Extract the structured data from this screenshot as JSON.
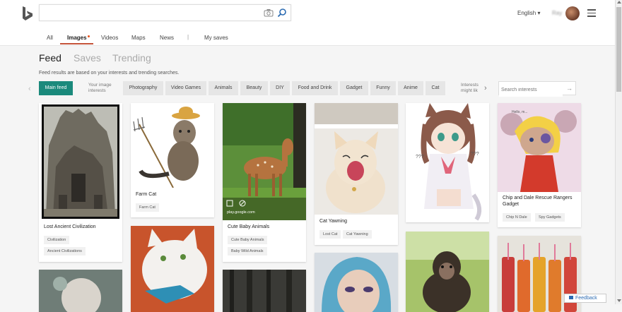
{
  "header": {
    "logo_icon": "bing-logo",
    "search_placeholder": "",
    "lang": "English ▾",
    "user": "Ray"
  },
  "nav": {
    "all": "All",
    "images": "Images",
    "videos": "Videos",
    "maps": "Maps",
    "news": "News",
    "sep": "|",
    "saves": "My saves"
  },
  "feed": {
    "tabs": [
      "Feed",
      "Saves",
      "Trending"
    ],
    "note": "Feed results are based on your interests and trending searches.",
    "main_feed": "Main feed",
    "your_image_interests": "Your image interests",
    "chips": [
      "Photography",
      "Video Games",
      "Animals",
      "Beauty",
      "DIY",
      "Food and Drink",
      "Gadget",
      "Funny",
      "Anime",
      "Cat"
    ],
    "interests_might": "Interests might lik",
    "search_interests_placeholder": "Search interests"
  },
  "cards": {
    "c1": {
      "title": "Lost Ancient Civilization",
      "tags": [
        "Civilization",
        "Ancient Civilizations"
      ]
    },
    "c2": {
      "title": "Farm Cat",
      "tags": [
        "Farm Cat"
      ]
    },
    "c3": {
      "title": "Cute Baby Animals",
      "tags": [
        "Cute Baby Animals",
        "Baby Wild Animals"
      ],
      "source": "play.google.com"
    },
    "c4": {
      "title": "Cat Yawning",
      "tags": [
        "Lost Cat",
        "Cat Yawning"
      ]
    },
    "c6": {
      "title": "Chip and Dale Rescue Rangers Gadget",
      "tags": [
        "Chip N Dale",
        "Spy Gadgets"
      ]
    }
  },
  "feedback": "Feedback",
  "colors": {
    "accent": "#1b8a7c",
    "nav_underline": "#c4533a",
    "link": "#2b6bb2"
  }
}
